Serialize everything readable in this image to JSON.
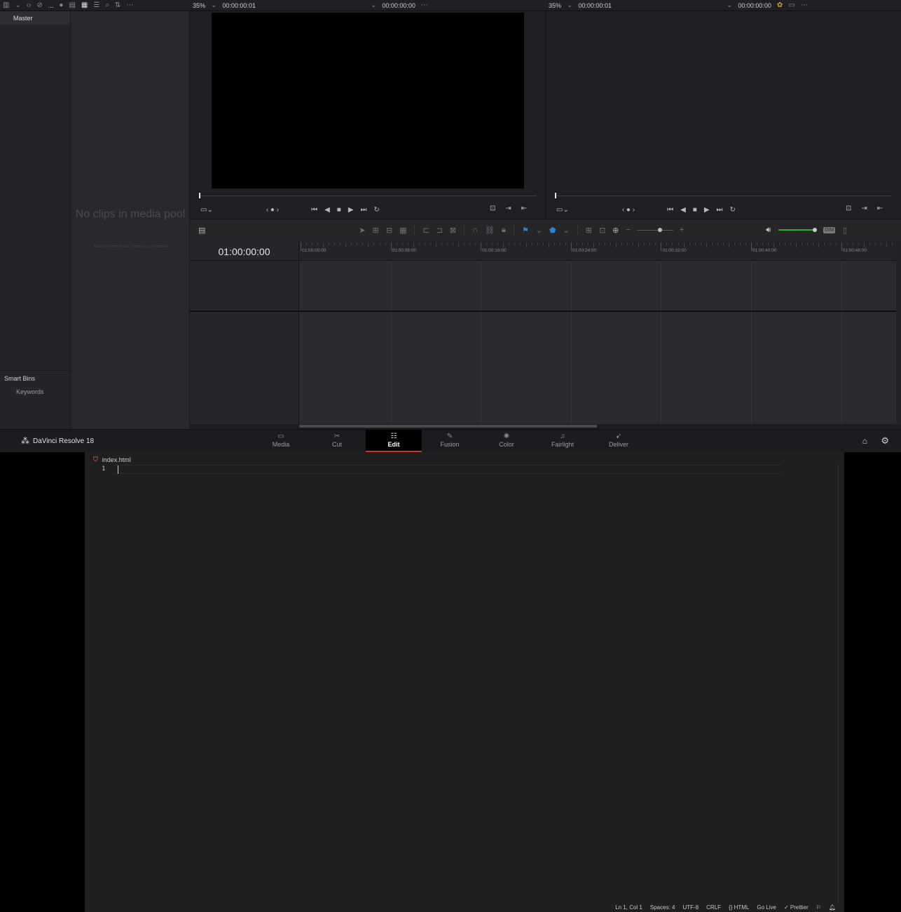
{
  "app": {
    "name": "DaVinci Resolve 18"
  },
  "media_pool_toolbar": {
    "more": "..."
  },
  "source_viewer": {
    "zoom": "35%",
    "timecode_left": "00:00:00:01",
    "timecode_right": "00:00:00:00"
  },
  "timeline_viewer": {
    "zoom": "35%",
    "timecode_left": "00:00:00:01",
    "timecode_right": "00:00:00:00"
  },
  "bins": {
    "master": "Master",
    "smart_bins": "Smart Bins",
    "keywords": "Keywords"
  },
  "media_pool": {
    "empty_title": "No clips in media pool",
    "empty_hint": "Add clips from Media Storage to get started"
  },
  "timeline": {
    "timecode": "01:00:00:00",
    "ruler_labels": [
      "01:00:00:00",
      "01:00:08:00",
      "01:00:16:00",
      "01:00:24:00",
      "01:00:32:00",
      "01:00:40:00",
      "01:00:48:00"
    ],
    "dim_label": "DIM"
  },
  "pages": [
    {
      "label": "Media",
      "icon": "media-page-icon"
    },
    {
      "label": "Cut",
      "icon": "cut-page-icon"
    },
    {
      "label": "Edit",
      "icon": "edit-page-icon",
      "active": true
    },
    {
      "label": "Fusion",
      "icon": "fusion-page-icon"
    },
    {
      "label": "Color",
      "icon": "color-page-icon"
    },
    {
      "label": "Fairlight",
      "icon": "fairlight-page-icon"
    },
    {
      "label": "Deliver",
      "icon": "deliver-page-icon"
    }
  ],
  "editor": {
    "tab": "index.html",
    "line_number": "1",
    "status": [
      "Ln 1, Col 1",
      "Spaces: 4",
      "UTF-8",
      "CRLF",
      "{} HTML",
      "Go Live",
      "✓ Prettier"
    ]
  },
  "colors": {
    "accent_red": "#c8342b",
    "volume_green": "#29b22c",
    "marker_blue": "#2e7fd8",
    "html_orange": "#e44d26"
  }
}
